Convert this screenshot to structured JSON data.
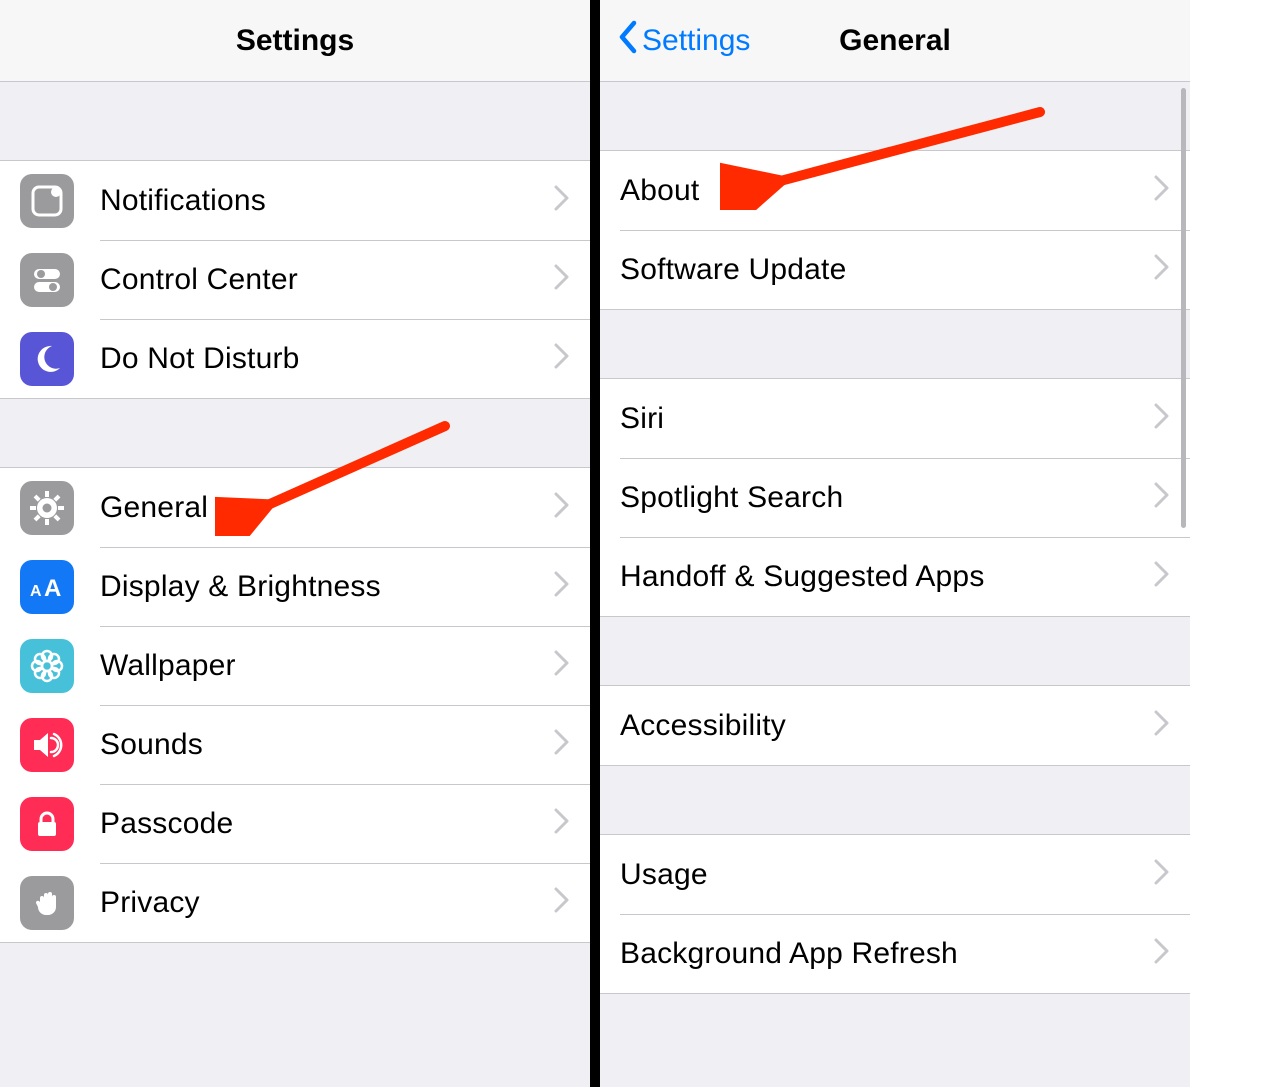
{
  "left": {
    "title": "Settings",
    "groups": [
      [
        {
          "id": "notifications",
          "label": "Notifications",
          "icon": "notifications-icon",
          "bg": "#9b9b9e",
          "fg": "#ffffff"
        },
        {
          "id": "control-center",
          "label": "Control Center",
          "icon": "control-center-icon",
          "bg": "#9b9b9e",
          "fg": "#ffffff"
        },
        {
          "id": "do-not-disturb",
          "label": "Do Not Disturb",
          "icon": "moon-icon",
          "bg": "#5856d6",
          "fg": "#ffffff"
        }
      ],
      [
        {
          "id": "general",
          "label": "General",
          "icon": "gear-icon",
          "bg": "#9b9b9e",
          "fg": "#ffffff"
        },
        {
          "id": "display-brightness",
          "label": "Display & Brightness",
          "icon": "text-size-icon",
          "bg": "#1278f5",
          "fg": "#ffffff"
        },
        {
          "id": "wallpaper",
          "label": "Wallpaper",
          "icon": "flower-icon",
          "bg": "#46c1d9",
          "fg": "#ffffff"
        },
        {
          "id": "sounds",
          "label": "Sounds",
          "icon": "speaker-icon",
          "bg": "#ff2d55",
          "fg": "#ffffff"
        },
        {
          "id": "passcode",
          "label": "Passcode",
          "icon": "lock-icon",
          "bg": "#ff2d55",
          "fg": "#ffffff"
        },
        {
          "id": "privacy",
          "label": "Privacy",
          "icon": "hand-icon",
          "bg": "#9b9b9e",
          "fg": "#ffffff"
        }
      ]
    ]
  },
  "right": {
    "back_label": "Settings",
    "title": "General",
    "groups": [
      [
        {
          "id": "about",
          "label": "About"
        },
        {
          "id": "software-update",
          "label": "Software Update"
        }
      ],
      [
        {
          "id": "siri",
          "label": "Siri"
        },
        {
          "id": "spotlight",
          "label": "Spotlight Search"
        },
        {
          "id": "handoff",
          "label": "Handoff & Suggested Apps"
        }
      ],
      [
        {
          "id": "accessibility",
          "label": "Accessibility"
        }
      ],
      [
        {
          "id": "usage",
          "label": "Usage"
        },
        {
          "id": "bg-refresh",
          "label": "Background App Refresh"
        }
      ]
    ]
  },
  "annotations": {
    "color": "#ff2a00"
  }
}
